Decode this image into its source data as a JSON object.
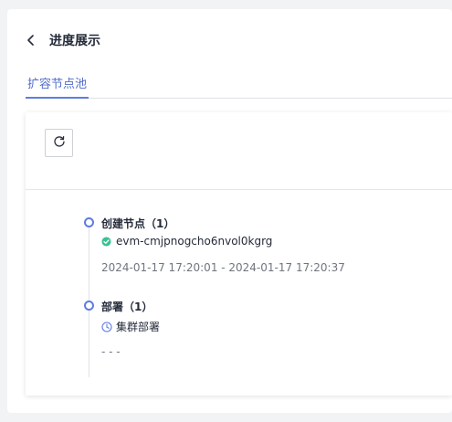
{
  "header": {
    "title": "进度展示"
  },
  "tabs": [
    {
      "label": "扩容节点池",
      "active": true
    }
  ],
  "colors": {
    "accent": "#5e7ce0",
    "success": "#3ac295",
    "text": "#252b3a",
    "muted": "#71757f"
  },
  "steps": [
    {
      "title": "创建节点（1）",
      "status": "success",
      "status_icon": "check-circle-icon",
      "item": "evm-cmjpnogcho6nvol0kgrg",
      "time": "2024-01-17 17:20:01 - 2024-01-17 17:20:37"
    },
    {
      "title": "部署（1）",
      "status": "pending",
      "status_icon": "clock-icon",
      "item": "集群部署",
      "time": "- - -"
    }
  ]
}
